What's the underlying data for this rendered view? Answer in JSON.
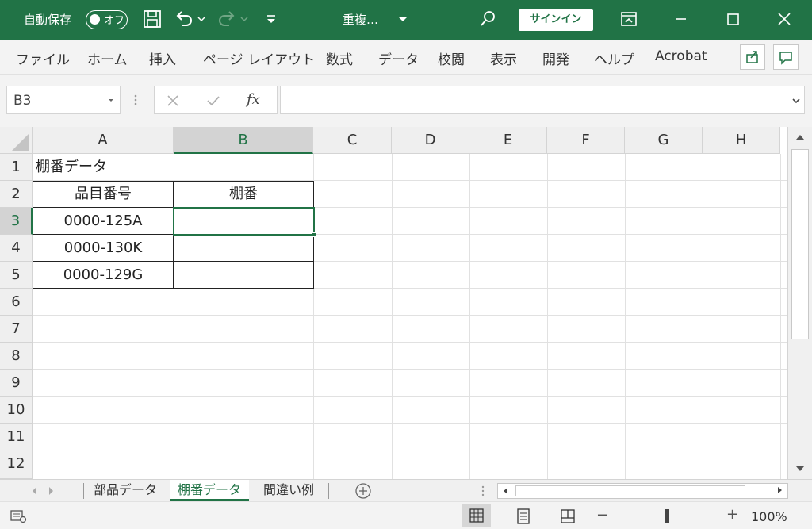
{
  "titlebar": {
    "autosave_label": "自動保存",
    "autosave_state": "オフ",
    "doc_title": "重複…",
    "signin_label": "サインイン",
    "bg_color": "#217346"
  },
  "ribbon": {
    "tabs": [
      "ファイル",
      "ホーム",
      "挿入",
      "ページ レイアウト",
      "数式",
      "データ",
      "校閲",
      "表示",
      "開発",
      "ヘルプ",
      "Acrobat"
    ]
  },
  "formula_bar": {
    "name_box": "B3",
    "fx_label": "fx",
    "value": ""
  },
  "grid": {
    "columns": [
      "A",
      "B",
      "C",
      "D",
      "E",
      "F",
      "G",
      "H"
    ],
    "selected_column": "B",
    "rows": [
      "1",
      "2",
      "3",
      "4",
      "5",
      "6",
      "7",
      "8",
      "9",
      "10",
      "11",
      "12"
    ],
    "selected_row": "3",
    "cells": {
      "A1": "棚番データ",
      "A2": "品目番号",
      "B2": "棚番",
      "A3": "0000-125A",
      "A4": "0000-130K",
      "A5": "0000-129G"
    },
    "active_cell": "B3"
  },
  "sheets": {
    "tabs": [
      "部品データ",
      "棚番データ",
      "間違い例"
    ],
    "active": "棚番データ"
  },
  "status": {
    "zoom": "100%",
    "accent": "#217346"
  }
}
